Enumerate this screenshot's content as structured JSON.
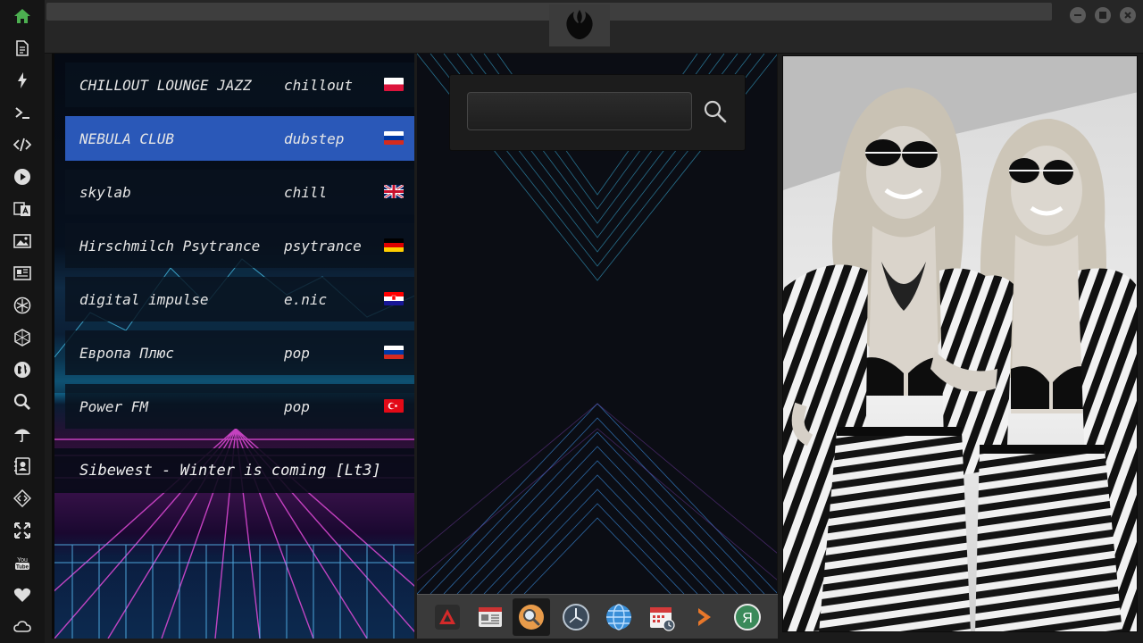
{
  "sidebar": {
    "icons": [
      "home-icon",
      "document-icon",
      "bolt-icon",
      "terminal-icon",
      "code-icon",
      "play-icon",
      "translate-icon",
      "image-icon",
      "newspaper-icon",
      "rebel-icon",
      "hexagon-icon",
      "globe-icon",
      "search-icon",
      "umbrella-icon",
      "contact-card-icon",
      "code-diamond-icon",
      "fullscreen-icon",
      "youtube-icon",
      "heart-icon",
      "cloud-icon"
    ],
    "youtube_label": "You Tube"
  },
  "window": {
    "minimize_icon": "minimize-icon",
    "maximize_icon": "maximize-icon",
    "close_icon": "close-icon"
  },
  "stations": [
    {
      "name": "CHILLOUT LOUNGE JAZZ",
      "genre": "chillout",
      "flag": "poland"
    },
    {
      "name": "NEBULA CLUB",
      "genre": "dubstep",
      "flag": "russia"
    },
    {
      "name": "skylab",
      "genre": "chill",
      "flag": "uk"
    },
    {
      "name": "Hirschmilch Psytrance",
      "genre": "psytrance",
      "flag": "germany"
    },
    {
      "name": "digital impulse",
      "genre": "e.nic",
      "flag": "croatia"
    },
    {
      "name": "Европа Плюс",
      "genre": "pop",
      "flag": "russia"
    },
    {
      "name": "Power FM",
      "genre": "pop",
      "flag": "turkey"
    }
  ],
  "active_station_index": 1,
  "now_playing": "Sibewest - Winter is coming [Lt3]",
  "search": {
    "value": "",
    "placeholder": ""
  },
  "dock": {
    "items": [
      "launcher-icon",
      "news-icon",
      "search-app-icon",
      "clock-icon",
      "browser-globe-icon",
      "calendar-icon",
      "terminal-arrow-icon",
      "yandex-icon"
    ],
    "active_index": 2,
    "yandex_label": "Я"
  },
  "colors": {
    "active_row": "#2a58b8",
    "sidebar_bg": "#151515",
    "accent_green": "#4caf50"
  }
}
